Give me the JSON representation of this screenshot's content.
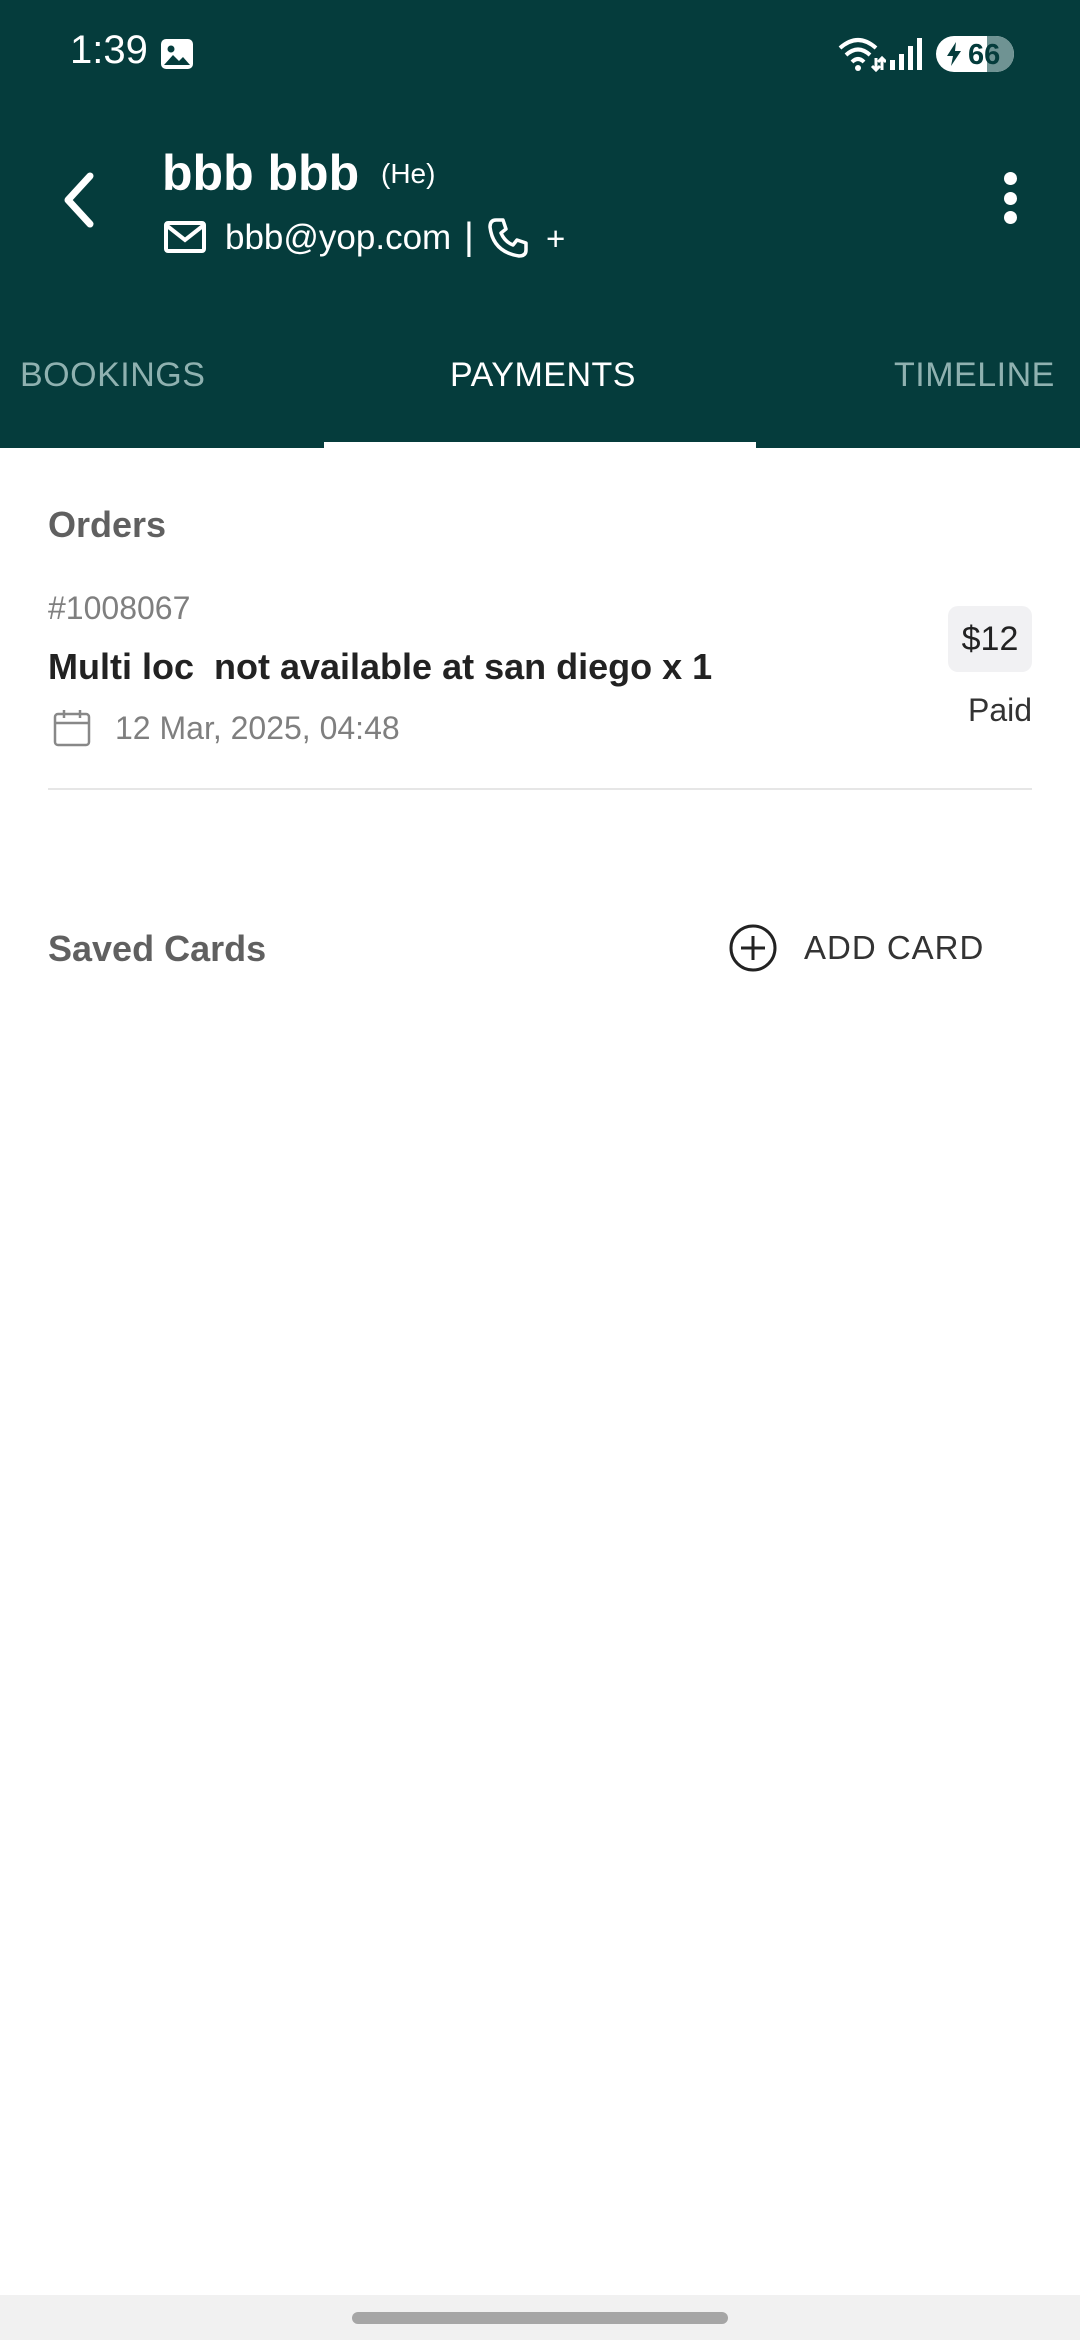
{
  "status_bar": {
    "time": "1:39",
    "battery": "66",
    "icons": [
      "gallery-icon",
      "wifi-icon",
      "signal-icon",
      "charging-icon"
    ]
  },
  "header": {
    "name": "bbb bbb",
    "pronoun": "(He)",
    "email": "bbb@yop.com",
    "separator": "|",
    "phone": "+",
    "icons": [
      "back-arrow-icon",
      "mail-icon",
      "phone-icon",
      "more-vertical-icon"
    ]
  },
  "tabs": [
    {
      "label": "BOOKINGS",
      "active": false
    },
    {
      "label": "PAYMENTS",
      "active": true
    },
    {
      "label": "TIMELINE",
      "active": false
    }
  ],
  "orders": {
    "title": "Orders",
    "items": [
      {
        "id": "#1008067",
        "title": "Multi loc  not available at san diego x 1",
        "date": "12 Mar, 2025, 04:48",
        "price": "$12",
        "status": "Paid"
      }
    ]
  },
  "saved_cards": {
    "title": "Saved Cards",
    "add_label": "ADD CARD"
  },
  "colors": {
    "header_bg": "#053c3c",
    "active_tab": "#ffffff",
    "inactive_tab": "#8fb1b0",
    "section_title": "#606060"
  }
}
